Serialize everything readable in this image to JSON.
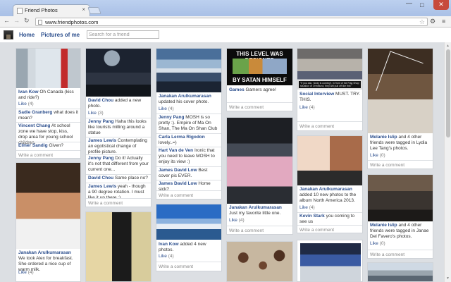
{
  "browser": {
    "tab_title": "Friend Photos",
    "tab_close": "×",
    "url": "www.friendphotos.com",
    "min": "—",
    "max": "□",
    "close": "✕",
    "back": "←",
    "forward": "→",
    "reload": "↻",
    "star": "☆",
    "ext": "⚙",
    "menu": "≡"
  },
  "site": {
    "nav_home": "Home",
    "nav_pictures": "Pictures of me",
    "search_placeholder": "Search for a friend"
  },
  "common": {
    "like": "Like",
    "write_comment": "Write a comment"
  },
  "cards": {
    "c1": {
      "caption_user": "Ivan Kow",
      "caption_text": " Oh Canada (kiss and ride?)",
      "likes": "(4)",
      "comments": [
        {
          "user": "Sadie Granberg",
          "text": " what does it mean?"
        },
        {
          "user": "Vincent Chang",
          "text": " At school zone we have stop, kiss, drop area for young school children."
        },
        {
          "user": "Elmer Sandig",
          "text": " Given?"
        }
      ]
    },
    "c2": {
      "caption_user": "David Chou",
      "caption_text": " added a new photo.",
      "likes": "(3)",
      "comments": [
        {
          "user": "Jenny Pang",
          "text": " Haha this looks like tourists milling around a statue"
        },
        {
          "user": "James Lewis",
          "text": " Contemplating an egotistical change of profile picture."
        },
        {
          "user": "Jenny Pang",
          "text": " Do it! Actually it's not that different from your current one..."
        },
        {
          "user": "David Chou",
          "text": " Same place no?"
        },
        {
          "user": "James Lewis",
          "text": " yeah - though a 90 degree rotation. I must like it up there :)"
        }
      ]
    },
    "c3": {
      "caption_user": "Janakan Arulkumarasan",
      "caption_text": " updated his cover photo.",
      "likes": "(4)",
      "comments": [
        {
          "user": "Jenny Pang",
          "text": " MOSH is so pretty :). Empire of Ma On Shan, The Ma On Shan Club"
        },
        {
          "user": "Carla Lerma Rigodon",
          "text": " lovely..=)"
        },
        {
          "user": "Hart Van de Ven",
          "text": " Ironic that you need to leave MOSH to enjoy its view :)"
        },
        {
          "user": "James David Low",
          "text": " Best cover pic EVER."
        },
        {
          "user": "James David Low",
          "text": " Home sick?"
        }
      ]
    },
    "c4": {
      "meme_top": "THIS LEVEL WAS DESIGNED",
      "meme_bottom": "BY SATAN HIMSELF",
      "caption_user": "Games",
      "caption_text": " Gamers agree!"
    },
    "c5": {
      "photo_caption": "\"If you ask, 'Andy is coming!', in front of the Flag Shop situation of Ormelund, they will pull off like this\"",
      "caption_user": "Social Interview",
      "caption_text": " MUST. TRY. THIS.",
      "likes": "(4)"
    },
    "c6": {
      "caption_user": "Melanie Islip",
      "caption_text": " and 4 other friends were tagged in Lydia Lee Tang's photos.",
      "likes": "(0)"
    },
    "c7": {
      "caption_user": "Janakan Arulkumarasan",
      "caption_text": " We took Alex for breakfast. She ordered a nice cup of warm milk.",
      "likes": "(4)"
    },
    "c8": {
      "caption_user": "Janakan Arulkumarasan",
      "caption_text": " Just my favorite little one.",
      "likes": "(4)"
    },
    "c9": {
      "caption_user": "Janakan Arulkumarasan",
      "caption_text": " added 10 new photos to the album North America 2013.",
      "likes": "(4)",
      "comments": [
        {
          "user": "Kevin Stark",
          "text": " you coming to see us"
        }
      ]
    },
    "c10": {
      "caption_user": "Melanie Islip",
      "caption_text": " and 4 other friends were tagged in Janae Del Favero's photos.",
      "likes": "(0)"
    },
    "c12": {
      "caption_user": "Ivan Kow",
      "caption_text": " added 4 new photos.",
      "likes": "(4)"
    }
  },
  "colors": {
    "link_blue": "#2a4d8c",
    "page_bg": "#dcdfe3",
    "close_red": "#c74b3d"
  }
}
